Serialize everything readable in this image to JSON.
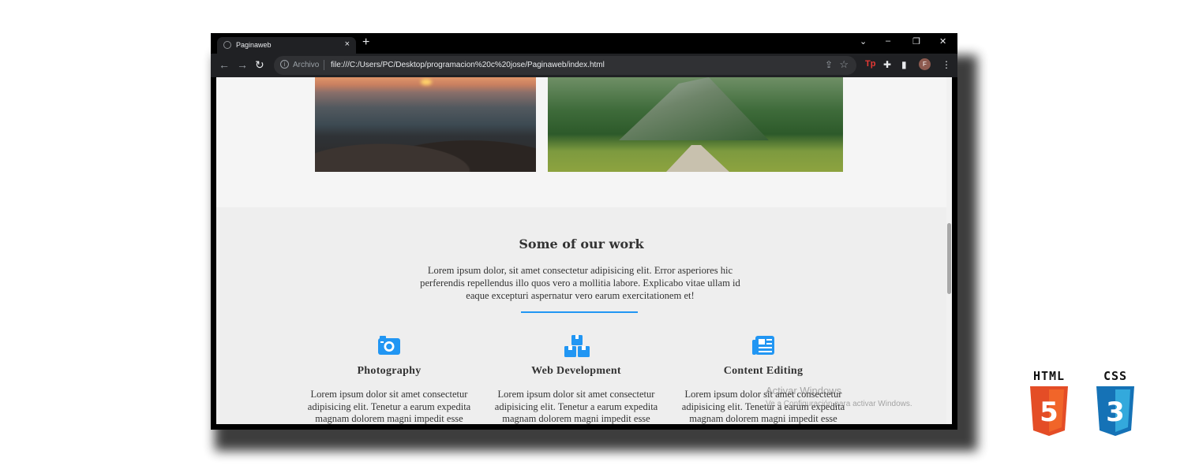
{
  "browser": {
    "tab_title": "Paginaweb",
    "tab_close": "×",
    "new_tab": "+",
    "window_controls": {
      "dropdown": "⌄",
      "minimize": "–",
      "restore": "❐",
      "close": "✕"
    },
    "nav": {
      "back": "←",
      "forward": "→",
      "reload": "↻"
    },
    "omnibox": {
      "info_glyph": "i",
      "security_label": "Archivo",
      "url": "file:///C:/Users/PC/Desktop/programacion%20c%20jose/Paginaweb/index.html",
      "share_glyph": "⇪",
      "bookmark_glyph": "☆"
    },
    "extensions": {
      "tp_label": "Tp",
      "puzzle_glyph": "✚",
      "sidepanel_glyph": "▮"
    },
    "profile_initial": "F",
    "menu_glyph": "⋮"
  },
  "page": {
    "section": {
      "title": "Some of our work",
      "description": "Lorem ipsum dolor, sit amet consectetur adipisicing elit. Error asperiores hic perferendis repellendus illo quos vero a mollitia labore. Explicabo vitae ullam id eaque excepturi aspernatur vero earum exercitationem et!"
    },
    "services": [
      {
        "title": "Photography",
        "icon": "camera-icon",
        "text": "Lorem ipsum dolor sit amet consectetur adipisicing elit. Tenetur a earum expedita magnam dolorem magni impedit esse"
      },
      {
        "title": "Web Development",
        "icon": "boxes-icon",
        "text": "Lorem ipsum dolor sit amet consectetur adipisicing elit. Tenetur a earum expedita magnam dolorem magni impedit esse"
      },
      {
        "title": "Content Editing",
        "icon": "newspaper-icon",
        "text": "Lorem ipsum dolor sit amet consectetur adipisicing elit. Tenetur a earum expedita magnam dolorem magni impedit esse"
      }
    ],
    "accent_color": "#2196f3"
  },
  "os_watermark": {
    "line1": "Activar Windows",
    "line2": "Ve a Configuración para activar Windows."
  },
  "logos": {
    "html": {
      "label": "HTML",
      "number": "5",
      "color": "#e44d26"
    },
    "css": {
      "label": "CSS",
      "number": "3",
      "color": "#1572b6"
    }
  }
}
